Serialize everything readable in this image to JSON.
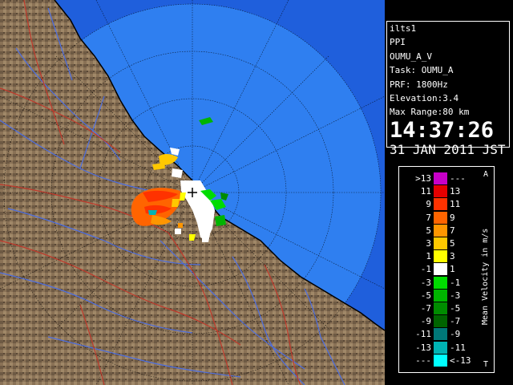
{
  "info": {
    "station": "ilts1",
    "product": "PPI",
    "task_name": "OUMU_A_V",
    "task": "Task: OUMU_A",
    "prf": "PRF: 1800Hz",
    "elevation": "Elevation:3.4",
    "max_range": "Max Range:80 km",
    "time": "14:37:26",
    "date": "31 JAN 2011 JST"
  },
  "legend": {
    "title": "Mean Velocity in m/s",
    "corner_top": "A",
    "corner_bottom": "T",
    "rows": [
      {
        "left": ">13",
        "right": "---",
        "color": "#c800c8"
      },
      {
        "left": "11",
        "right": "13",
        "color": "#e60000"
      },
      {
        "left": "9",
        "right": "11",
        "color": "#ff3200"
      },
      {
        "left": "7",
        "right": "9",
        "color": "#ff6400"
      },
      {
        "left": "5",
        "right": "7",
        "color": "#ff9600"
      },
      {
        "left": "3",
        "right": "5",
        "color": "#ffc800"
      },
      {
        "left": "1",
        "right": "3",
        "color": "#ffff00"
      },
      {
        "left": "-1",
        "right": "1",
        "color": "#ffffff"
      },
      {
        "left": "-3",
        "right": "-1",
        "color": "#00dc00"
      },
      {
        "left": "-5",
        "right": "-3",
        "color": "#00b400"
      },
      {
        "left": "-7",
        "right": "-5",
        "color": "#008c00"
      },
      {
        "left": "-9",
        "right": "-7",
        "color": "#006400"
      },
      {
        "left": "-11",
        "right": "-9",
        "color": "#007878"
      },
      {
        "left": "-13",
        "right": "-11",
        "color": "#00b4b4"
      },
      {
        "left": "---",
        "right": "<-13",
        "color": "#00ffff"
      }
    ]
  },
  "map": {
    "sea_color": "#2f7ff0",
    "sea_outer_color": "#1f5fdc",
    "land_color": "#8c7458",
    "river_color": "#4d6ee0",
    "border_color": "#c0392b"
  }
}
